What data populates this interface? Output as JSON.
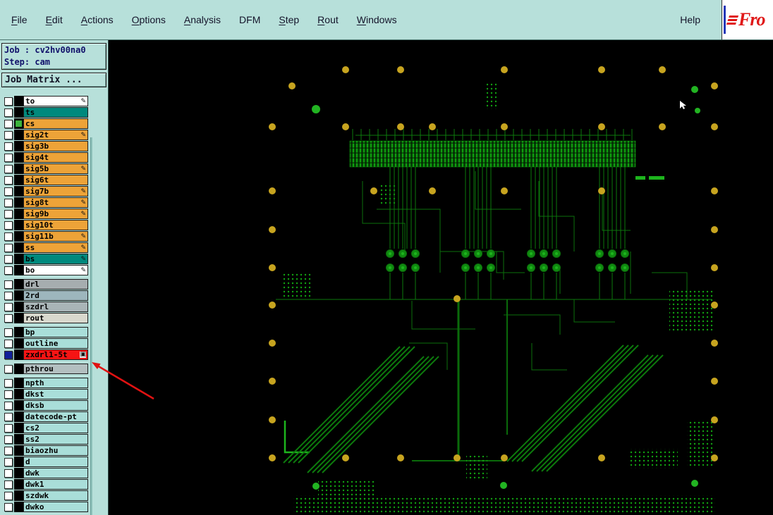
{
  "menubar": {
    "items": [
      {
        "label": "File",
        "underline": 0
      },
      {
        "label": "Edit",
        "underline": 0
      },
      {
        "label": "Actions",
        "underline": 0
      },
      {
        "label": "Options",
        "underline": 0
      },
      {
        "label": "Analysis",
        "underline": 0
      },
      {
        "label": "DFM",
        "underline": -1
      },
      {
        "label": "Step",
        "underline": 0
      },
      {
        "label": "Rout",
        "underline": 0
      },
      {
        "label": "Windows",
        "underline": 0
      }
    ],
    "help_label": "Help"
  },
  "logo": {
    "text": "Fro"
  },
  "job_panel": {
    "job": "Job : cv2hv00na0",
    "step": "Step: cam",
    "matrix": "Job Matrix ..."
  },
  "layer_list": {
    "groups": [
      {
        "layers": [
          {
            "name": "to",
            "bg": "#ffffff",
            "pencil": true
          },
          {
            "name": "ts",
            "bg": "#00897d",
            "pencil": false
          },
          {
            "name": "cs",
            "bg": "#eda338",
            "pencil": false,
            "swatch": "#3cb43c"
          },
          {
            "name": "sig2t",
            "bg": "#eda338",
            "pencil": true
          },
          {
            "name": "sig3b",
            "bg": "#eda338",
            "pencil": false
          },
          {
            "name": "sig4t",
            "bg": "#eda338",
            "pencil": false
          },
          {
            "name": "sig5b",
            "bg": "#eda338",
            "pencil": true
          },
          {
            "name": "sig6t",
            "bg": "#eda338",
            "pencil": false
          },
          {
            "name": "sig7b",
            "bg": "#eda338",
            "pencil": true
          },
          {
            "name": "sig8t",
            "bg": "#eda338",
            "pencil": true
          },
          {
            "name": "sig9b",
            "bg": "#eda338",
            "pencil": true
          },
          {
            "name": "sig10t",
            "bg": "#eda338",
            "pencil": false
          },
          {
            "name": "sig11b",
            "bg": "#eda338",
            "pencil": true
          },
          {
            "name": "ss",
            "bg": "#eda338",
            "pencil": true
          },
          {
            "name": "bs",
            "bg": "#00897d",
            "pencil": true
          },
          {
            "name": "bo",
            "bg": "#ffffff",
            "pencil": true
          }
        ]
      },
      {
        "layers": [
          {
            "name": "drl",
            "bg": "#a6adaf"
          },
          {
            "name": "2rd",
            "bg": "#9db6bd"
          },
          {
            "name": "szdrl",
            "bg": "#a9b5b7"
          },
          {
            "name": "rout",
            "bg": "#d8d8cd"
          }
        ]
      },
      {
        "layers": [
          {
            "name": "bp",
            "bg": "#a9ded9"
          },
          {
            "name": "outline",
            "bg": "#a9ded9"
          },
          {
            "name": "zxdrl1-5t",
            "bg": "#f61414",
            "checkbox": "#10209a",
            "icon": true
          }
        ]
      },
      {
        "layers": [
          {
            "name": "pthrou",
            "bg": "#b3bfc0"
          }
        ]
      },
      {
        "layers": [
          {
            "name": "npth",
            "bg": "#a9ded9"
          },
          {
            "name": "dkst",
            "bg": "#a9ded9"
          },
          {
            "name": "dksb",
            "bg": "#a9ded9"
          },
          {
            "name": "datecode-pt",
            "bg": "#a9ded9"
          },
          {
            "name": "cs2",
            "bg": "#a9ded9"
          },
          {
            "name": "ss2",
            "bg": "#a9ded9"
          },
          {
            "name": "biaozhu",
            "bg": "#a9ded9"
          },
          {
            "name": "d",
            "bg": "#a9ded9"
          },
          {
            "name": "dwk",
            "bg": "#a9ded9"
          },
          {
            "name": "dwk1",
            "bg": "#a9ded9"
          },
          {
            "name": "szdwk",
            "bg": "#a9ded9"
          },
          {
            "name": "dwko",
            "bg": "#a9ded9"
          }
        ]
      }
    ]
  },
  "colors": {
    "trace": "#0d7a0d",
    "trace_bright": "#1db41d",
    "pad_yellow": "#c7a41f",
    "pad_green": "#22b422",
    "arrow": "#e11212",
    "panel_teal": "#b7e0da"
  }
}
